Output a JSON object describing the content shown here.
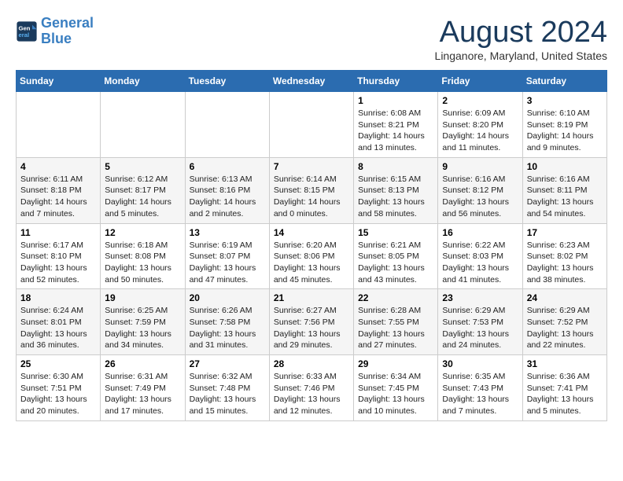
{
  "logo": {
    "line1": "General",
    "line2": "Blue"
  },
  "header": {
    "month": "August 2024",
    "location": "Linganore, Maryland, United States"
  },
  "weekdays": [
    "Sunday",
    "Monday",
    "Tuesday",
    "Wednesday",
    "Thursday",
    "Friday",
    "Saturday"
  ],
  "weeks": [
    [
      {
        "day": "",
        "info": ""
      },
      {
        "day": "",
        "info": ""
      },
      {
        "day": "",
        "info": ""
      },
      {
        "day": "",
        "info": ""
      },
      {
        "day": "1",
        "info": "Sunrise: 6:08 AM\nSunset: 8:21 PM\nDaylight: 14 hours\nand 13 minutes."
      },
      {
        "day": "2",
        "info": "Sunrise: 6:09 AM\nSunset: 8:20 PM\nDaylight: 14 hours\nand 11 minutes."
      },
      {
        "day": "3",
        "info": "Sunrise: 6:10 AM\nSunset: 8:19 PM\nDaylight: 14 hours\nand 9 minutes."
      }
    ],
    [
      {
        "day": "4",
        "info": "Sunrise: 6:11 AM\nSunset: 8:18 PM\nDaylight: 14 hours\nand 7 minutes."
      },
      {
        "day": "5",
        "info": "Sunrise: 6:12 AM\nSunset: 8:17 PM\nDaylight: 14 hours\nand 5 minutes."
      },
      {
        "day": "6",
        "info": "Sunrise: 6:13 AM\nSunset: 8:16 PM\nDaylight: 14 hours\nand 2 minutes."
      },
      {
        "day": "7",
        "info": "Sunrise: 6:14 AM\nSunset: 8:15 PM\nDaylight: 14 hours\nand 0 minutes."
      },
      {
        "day": "8",
        "info": "Sunrise: 6:15 AM\nSunset: 8:13 PM\nDaylight: 13 hours\nand 58 minutes."
      },
      {
        "day": "9",
        "info": "Sunrise: 6:16 AM\nSunset: 8:12 PM\nDaylight: 13 hours\nand 56 minutes."
      },
      {
        "day": "10",
        "info": "Sunrise: 6:16 AM\nSunset: 8:11 PM\nDaylight: 13 hours\nand 54 minutes."
      }
    ],
    [
      {
        "day": "11",
        "info": "Sunrise: 6:17 AM\nSunset: 8:10 PM\nDaylight: 13 hours\nand 52 minutes."
      },
      {
        "day": "12",
        "info": "Sunrise: 6:18 AM\nSunset: 8:08 PM\nDaylight: 13 hours\nand 50 minutes."
      },
      {
        "day": "13",
        "info": "Sunrise: 6:19 AM\nSunset: 8:07 PM\nDaylight: 13 hours\nand 47 minutes."
      },
      {
        "day": "14",
        "info": "Sunrise: 6:20 AM\nSunset: 8:06 PM\nDaylight: 13 hours\nand 45 minutes."
      },
      {
        "day": "15",
        "info": "Sunrise: 6:21 AM\nSunset: 8:05 PM\nDaylight: 13 hours\nand 43 minutes."
      },
      {
        "day": "16",
        "info": "Sunrise: 6:22 AM\nSunset: 8:03 PM\nDaylight: 13 hours\nand 41 minutes."
      },
      {
        "day": "17",
        "info": "Sunrise: 6:23 AM\nSunset: 8:02 PM\nDaylight: 13 hours\nand 38 minutes."
      }
    ],
    [
      {
        "day": "18",
        "info": "Sunrise: 6:24 AM\nSunset: 8:01 PM\nDaylight: 13 hours\nand 36 minutes."
      },
      {
        "day": "19",
        "info": "Sunrise: 6:25 AM\nSunset: 7:59 PM\nDaylight: 13 hours\nand 34 minutes."
      },
      {
        "day": "20",
        "info": "Sunrise: 6:26 AM\nSunset: 7:58 PM\nDaylight: 13 hours\nand 31 minutes."
      },
      {
        "day": "21",
        "info": "Sunrise: 6:27 AM\nSunset: 7:56 PM\nDaylight: 13 hours\nand 29 minutes."
      },
      {
        "day": "22",
        "info": "Sunrise: 6:28 AM\nSunset: 7:55 PM\nDaylight: 13 hours\nand 27 minutes."
      },
      {
        "day": "23",
        "info": "Sunrise: 6:29 AM\nSunset: 7:53 PM\nDaylight: 13 hours\nand 24 minutes."
      },
      {
        "day": "24",
        "info": "Sunrise: 6:29 AM\nSunset: 7:52 PM\nDaylight: 13 hours\nand 22 minutes."
      }
    ],
    [
      {
        "day": "25",
        "info": "Sunrise: 6:30 AM\nSunset: 7:51 PM\nDaylight: 13 hours\nand 20 minutes."
      },
      {
        "day": "26",
        "info": "Sunrise: 6:31 AM\nSunset: 7:49 PM\nDaylight: 13 hours\nand 17 minutes."
      },
      {
        "day": "27",
        "info": "Sunrise: 6:32 AM\nSunset: 7:48 PM\nDaylight: 13 hours\nand 15 minutes."
      },
      {
        "day": "28",
        "info": "Sunrise: 6:33 AM\nSunset: 7:46 PM\nDaylight: 13 hours\nand 12 minutes."
      },
      {
        "day": "29",
        "info": "Sunrise: 6:34 AM\nSunset: 7:45 PM\nDaylight: 13 hours\nand 10 minutes."
      },
      {
        "day": "30",
        "info": "Sunrise: 6:35 AM\nSunset: 7:43 PM\nDaylight: 13 hours\nand 7 minutes."
      },
      {
        "day": "31",
        "info": "Sunrise: 6:36 AM\nSunset: 7:41 PM\nDaylight: 13 hours\nand 5 minutes."
      }
    ]
  ]
}
